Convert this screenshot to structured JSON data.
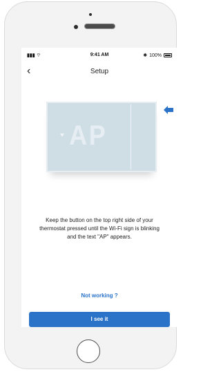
{
  "status": {
    "signal_wifi": "••••  ",
    "time": "9:41 AM",
    "bluetooth": "✱",
    "battery_text": "100%"
  },
  "nav": {
    "back_glyph": "‹",
    "title": "Setup"
  },
  "thermostat": {
    "display_text": "AP"
  },
  "instructions": {
    "line1": "Keep the button on the top right side of your",
    "line2": "thermostat pressed until the Wi-Fi sign is blinking",
    "line3": "and the text \"AP\" appears."
  },
  "actions": {
    "not_working": "Not working ?",
    "primary": "I see it"
  },
  "colors": {
    "accent": "#2a73c9",
    "device": "#cfdde4"
  }
}
